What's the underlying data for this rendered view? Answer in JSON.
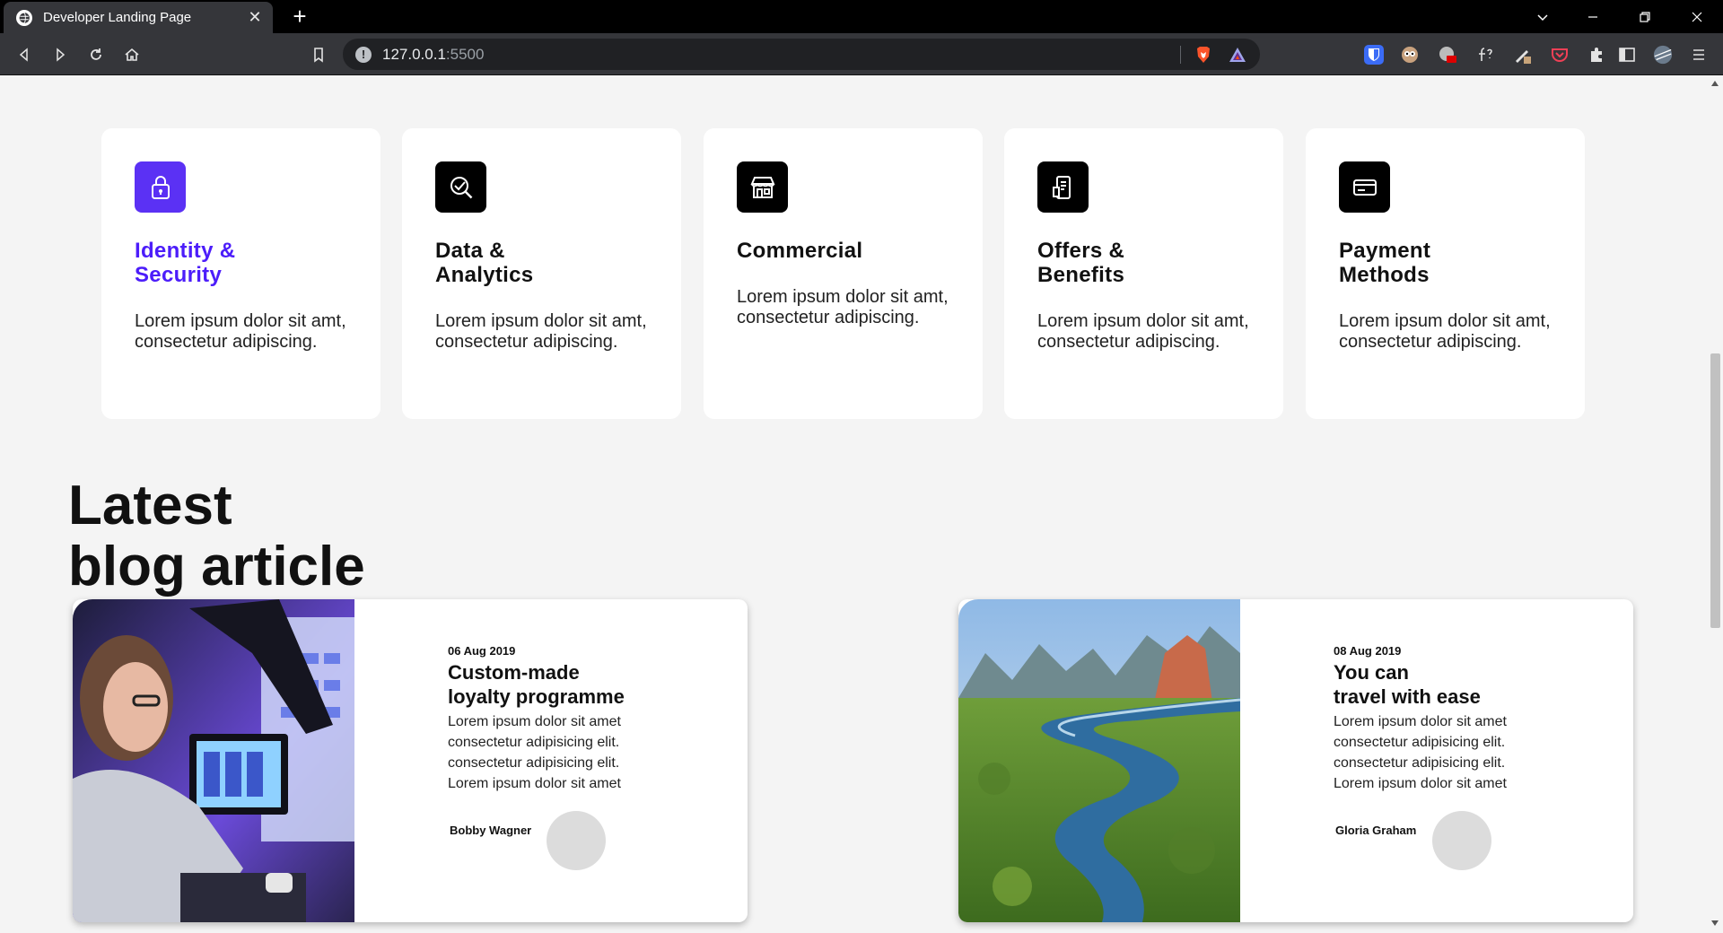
{
  "browser": {
    "tab_title": "Developer Landing Page",
    "tab_close": "✕",
    "new_tab": "+",
    "url_host": "127.0.0.1",
    "url_port": ":5500"
  },
  "features": [
    {
      "title": "Identity & Security",
      "text": "Lorem ipsum dolor sit amt, consectetur adipiscing.",
      "icon": "lock-icon",
      "active": true
    },
    {
      "title": "Data & Analytics",
      "text": "Lorem ipsum dolor sit amt, consectetur adipiscing.",
      "icon": "analytics-icon",
      "active": false
    },
    {
      "title": "Commercial",
      "text": "Lorem ipsum dolor sit amt, consectetur adipiscing.",
      "icon": "store-icon",
      "active": false
    },
    {
      "title": "Offers & Benefits",
      "text": "Lorem ipsum dolor sit amt, consectetur adipiscing.",
      "icon": "mobile-offer-icon",
      "active": false
    },
    {
      "title": "Payment Methods",
      "text": "Lorem ipsum dolor sit amt, consectetur adipiscing.",
      "icon": "card-icon",
      "active": false
    }
  ],
  "colors": {
    "accent": "#4c1dfa",
    "icon_bg_active": "#5b31f4",
    "icon_bg": "#000000"
  },
  "blog": {
    "heading_line1": "Latest",
    "heading_line2": "blog article",
    "articles": [
      {
        "date": "06 Aug 2019",
        "title_line1": "Custom-made",
        "title_line2": "loyalty programme",
        "excerpt": [
          "Lorem ipsum dolor sit amet",
          "consectetur adipisicing elit.",
          "consectetur adipisicing elit.",
          "Lorem ipsum dolor sit amet"
        ],
        "author": "Bobby Wagner"
      },
      {
        "date": "08 Aug 2019",
        "title_line1": "You can",
        "title_line2": "travel with ease",
        "excerpt": [
          "Lorem ipsum dolor sit amet",
          "consectetur adipisicing elit.",
          "consectetur adipisicing elit.",
          "Lorem ipsum dolor sit amet"
        ],
        "author": "Gloria Graham"
      }
    ]
  }
}
